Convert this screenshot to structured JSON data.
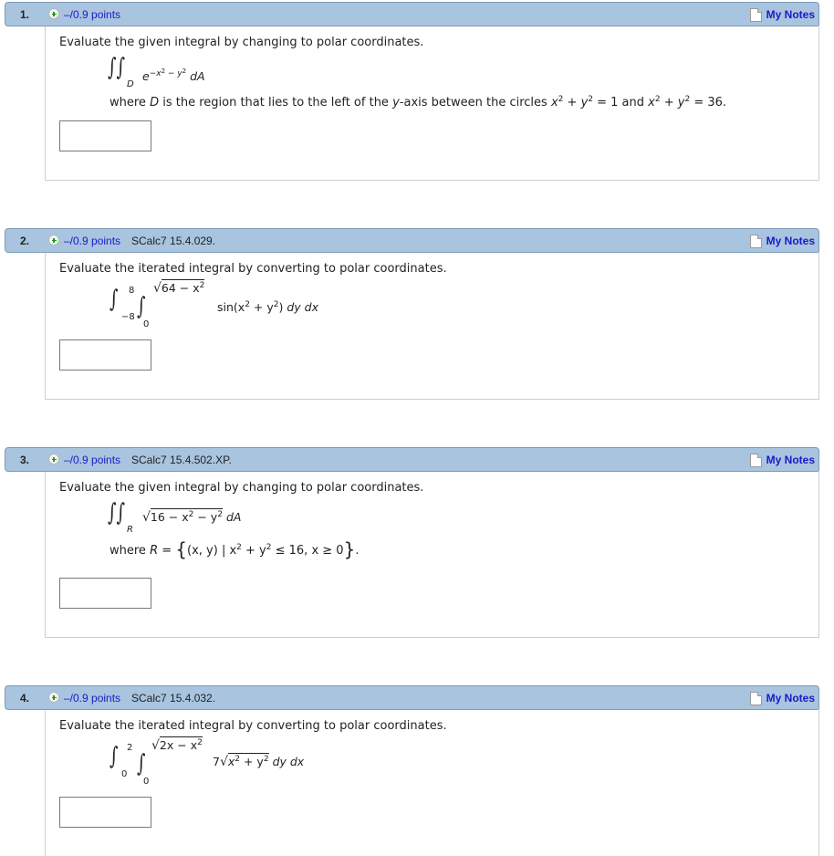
{
  "questions": [
    {
      "number": "1.",
      "points": "–/0.9 points",
      "reference": "",
      "notes_label": "My Notes",
      "prompt": "Evaluate the given integral by changing to polar coordinates.",
      "integral": {
        "region": "D",
        "integrand_base": "e",
        "exponent": "−x2 − y2",
        "exp_a": "−x",
        "exp_sup1": "2",
        "exp_b": " − y",
        "exp_sup2": "2",
        "differential": "dA"
      },
      "condition": {
        "prefix": "where ",
        "var": "D",
        "text1": " is the region that lies to the left of the ",
        "axis": "y",
        "text2": "-axis between the circles ",
        "c1x": "x",
        "c1y": "y",
        "c1rest": " = 1 and ",
        "c2x": "x",
        "c2y": "y",
        "c2rest": " = 36.",
        "sq": "2"
      },
      "answer_value": ""
    },
    {
      "number": "2.",
      "points": "–/0.9 points",
      "reference": "SCalc7 15.4.029.",
      "notes_label": "My Notes",
      "prompt": "Evaluate the iterated integral by converting to polar coordinates.",
      "integral": {
        "outer_upper": "8",
        "outer_lower": "−8",
        "inner_lower": "0",
        "inner_upper": "64 − x2",
        "inner_upper_a": "64 − x",
        "sq": "2",
        "integrand_a": "sin(x",
        "integrand_b": " + y",
        "integrand_c": ")",
        "differential": "dy dx"
      },
      "answer_value": ""
    },
    {
      "number": "3.",
      "points": "–/0.9 points",
      "reference": "SCalc7 15.4.502.XP.",
      "notes_label": "My Notes",
      "prompt": "Evaluate the given integral by changing to polar coordinates.",
      "integral": {
        "region": "R",
        "radicand_a": "16 − x",
        "radicand_b": " − y",
        "sq": "2",
        "differential": "dA"
      },
      "condition": {
        "prefix": "where ",
        "var": "R",
        "eq": " = ",
        "set_a": "(x, y) | x",
        "set_b": " + y",
        "set_c": " ≤ 16, x ≥ 0",
        "suffix": "."
      },
      "answer_value": ""
    },
    {
      "number": "4.",
      "points": "–/0.9 points",
      "reference": "SCalc7 15.4.032.",
      "notes_label": "My Notes",
      "prompt": "Evaluate the iterated integral by converting to polar coordinates.",
      "integral": {
        "outer_upper": "2",
        "outer_lower": "0",
        "inner_lower": "0",
        "inner_upper_a": "2x − x",
        "sq": "2",
        "coef": "7",
        "radicand_a": "x",
        "radicand_b": " + y",
        "differential": "dy dx"
      },
      "answer_value": ""
    }
  ],
  "colors": {
    "header_bg": "#a8c4df",
    "link": "#1a1ac8",
    "plus_icon": "#1a9a1a"
  }
}
